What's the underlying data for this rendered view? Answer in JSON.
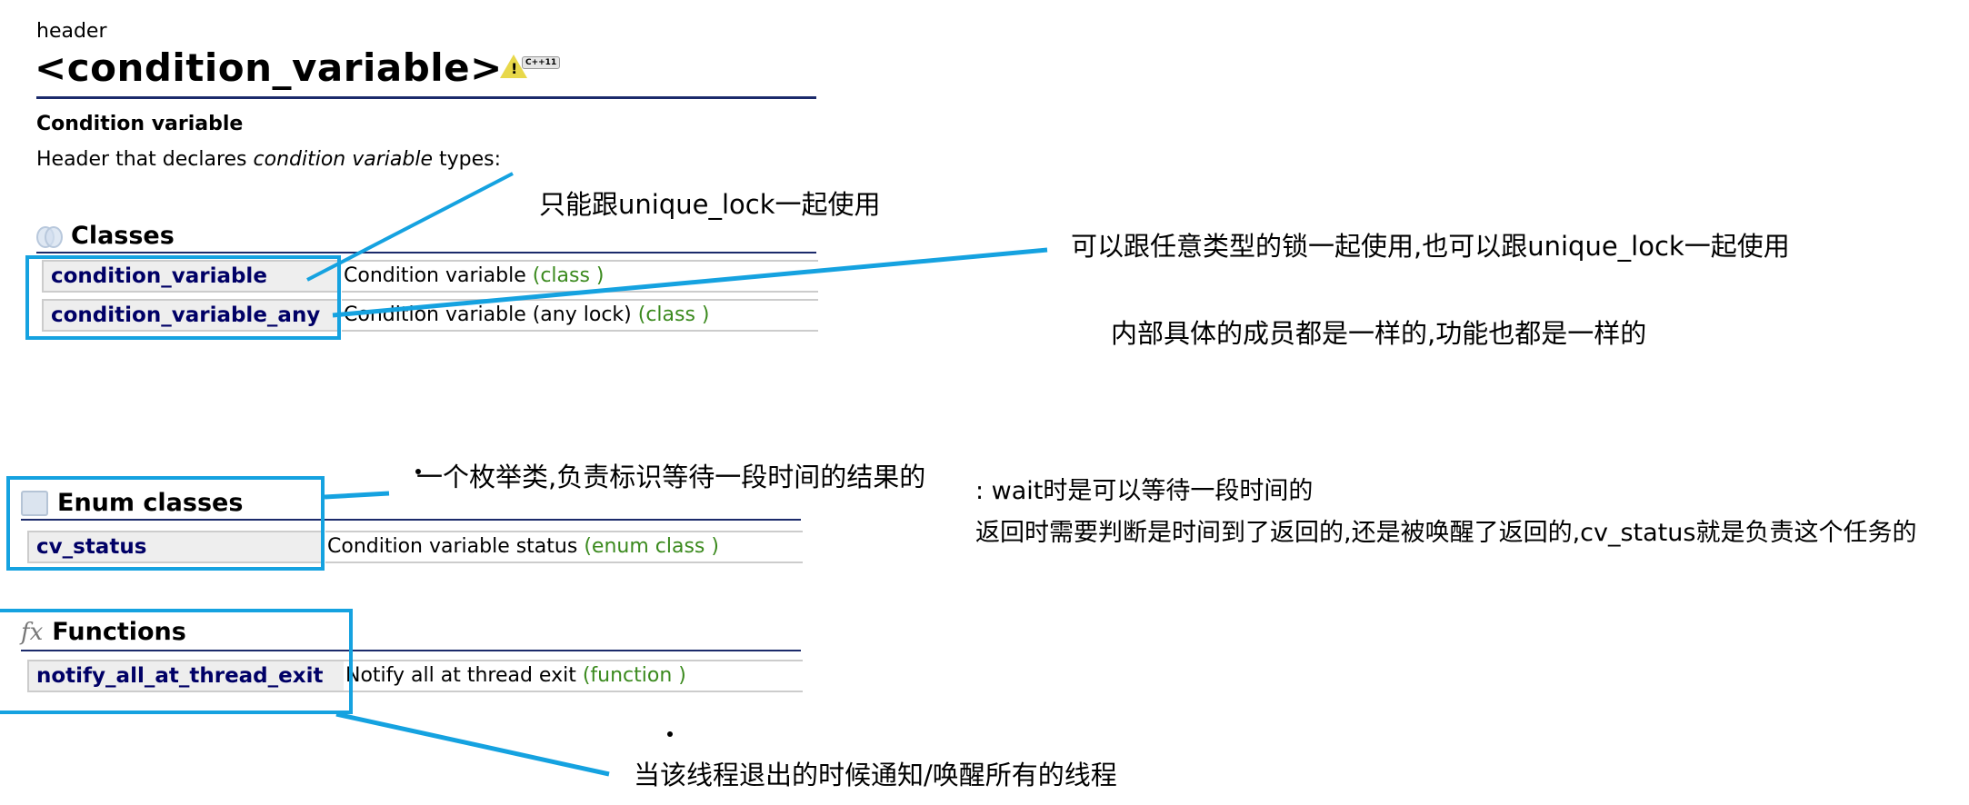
{
  "page": {
    "kind_label": "header",
    "title": "<condition_variable>",
    "badge_text": "C++11",
    "subtitle": "Condition variable",
    "description": {
      "before": "Header that declares ",
      "emphasis": "condition variable",
      "after": " types:"
    }
  },
  "sections": {
    "classes": {
      "heading": "Classes",
      "icon": "classes-icon",
      "rows": [
        {
          "name": "condition_variable",
          "desc": "Condition variable",
          "kind": "(class )"
        },
        {
          "name": "condition_variable_any",
          "desc": "Condition variable (any lock)",
          "kind": "(class )"
        }
      ]
    },
    "enums": {
      "heading": "Enum classes",
      "icon": "enum-icon",
      "rows": [
        {
          "name": "cv_status",
          "desc": "Condition variable status",
          "kind": "(enum class )"
        }
      ]
    },
    "functions": {
      "heading": "Functions",
      "icon": "fx-icon",
      "icon_glyph": "fx",
      "rows": [
        {
          "name": "notify_all_at_thread_exit",
          "desc": "Notify all at thread exit",
          "kind": "(function )"
        }
      ]
    }
  },
  "annotations": {
    "cv_only_unique_lock": "只能跟unique_lock一起使用",
    "cv_any_any_lock": "可以跟任意类型的锁一起使用,也可以跟unique_lock一起使用",
    "same_members": "内部具体的成员都是一样的,功能也都是一样的",
    "enum_purpose": "一个枚举类,负责标识等待一段时间的结果的",
    "wait_timeout": ": wait时是可以等待一段时间的",
    "cv_status_role": "返回时需要判断是时间到了返回的,还是被唤醒了返回的,cv_status就是负责这个任务的",
    "notify_all_desc": "当该线程退出的时候通知/唤醒所有的线程"
  },
  "colors": {
    "annotation_blue": "#15a2e0",
    "rule_navy": "#1b2a6b",
    "name_navy": "#000066",
    "kind_green": "#3b8a1e"
  }
}
